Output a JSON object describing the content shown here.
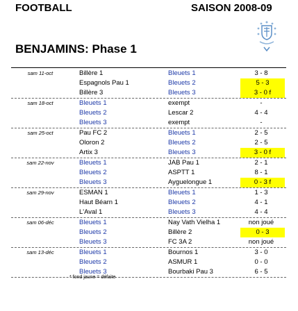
{
  "header": {
    "left_title": "FOOTBALL",
    "right_title": "SAISON 2008-09"
  },
  "subtitle": "BENJAMINS: Phase 1",
  "colors": {
    "blue_team": "#1e3aa8",
    "defeat_highlight": "#ffff00"
  },
  "groups": [
    {
      "date": "sam 11-oct",
      "rows": [
        {
          "home": "Billère 1",
          "home_blue": false,
          "away": "Bleuets 1",
          "away_blue": true,
          "score": "3 - 8",
          "highlight": false
        },
        {
          "home": "Espagnols Pau 1",
          "home_blue": false,
          "away": "Bleuets 2",
          "away_blue": true,
          "score": "5 - 3",
          "highlight": true
        },
        {
          "home": "Billère 3",
          "home_blue": false,
          "away": "Bleuets 3",
          "away_blue": true,
          "score": "3 - 0 f",
          "highlight": true
        }
      ]
    },
    {
      "date": "sam 18-oct",
      "rows": [
        {
          "home": "Bleuets 1",
          "home_blue": true,
          "away": "exempt",
          "away_blue": false,
          "score": "-",
          "highlight": false
        },
        {
          "home": "Bleuets 2",
          "home_blue": true,
          "away": "Lescar 2",
          "away_blue": false,
          "score": "4 - 4",
          "highlight": false
        },
        {
          "home": "Bleuets 3",
          "home_blue": true,
          "away": "exempt",
          "away_blue": false,
          "score": "-",
          "highlight": false
        }
      ]
    },
    {
      "date": "sam 25-oct",
      "rows": [
        {
          "home": "Pau FC 2",
          "home_blue": false,
          "away": "Bleuets 1",
          "away_blue": true,
          "score": "2 - 5",
          "highlight": false
        },
        {
          "home": "Oloron 2",
          "home_blue": false,
          "away": "Bleuets 2",
          "away_blue": true,
          "score": "2 - 5",
          "highlight": false
        },
        {
          "home": "Artix 3",
          "home_blue": false,
          "away": "Bleuets 3",
          "away_blue": true,
          "score": "3 - 0 f",
          "highlight": true
        }
      ]
    },
    {
      "date": "sam 22-nov",
      "rows": [
        {
          "home": "Bleuets 1",
          "home_blue": true,
          "away": "JAB Pau 1",
          "away_blue": false,
          "score": "2 - 1",
          "highlight": false
        },
        {
          "home": "Bleuets 2",
          "home_blue": true,
          "away": "ASPTT 1",
          "away_blue": false,
          "score": "8 - 1",
          "highlight": false
        },
        {
          "home": "Bleuets 3",
          "home_blue": true,
          "away": "Ayguelongue 1",
          "away_blue": false,
          "score": "0 - 3 f",
          "highlight": true
        }
      ]
    },
    {
      "date": "sam 29-nov",
      "rows": [
        {
          "home": "ESMAN 1",
          "home_blue": false,
          "away": "Bleuets 1",
          "away_blue": true,
          "score": "1 - 3",
          "highlight": false
        },
        {
          "home": "Haut Béarn 1",
          "home_blue": false,
          "away": "Bleuets 2",
          "away_blue": true,
          "score": "4 - 1",
          "highlight": false
        },
        {
          "home": "L'Aval 1",
          "home_blue": false,
          "away": "Bleuets 3",
          "away_blue": true,
          "score": "4 - 4",
          "highlight": false
        }
      ]
    },
    {
      "date": "sam 06-déc",
      "rows": [
        {
          "home": "Bleuets 1",
          "home_blue": true,
          "away": "Nay Vath Vielha 1",
          "away_blue": false,
          "score": "non joué",
          "highlight": false
        },
        {
          "home": "Bleuets 2",
          "home_blue": true,
          "away": "Billère 2",
          "away_blue": false,
          "score": "0 - 3",
          "highlight": true
        },
        {
          "home": "Bleuets 3",
          "home_blue": true,
          "away": "FC 3A 2",
          "away_blue": false,
          "score": "non joué",
          "highlight": false
        }
      ]
    },
    {
      "date": "sam 13-déc",
      "rows": [
        {
          "home": "Bleuets 1",
          "home_blue": true,
          "away": "Bournos 1",
          "away_blue": false,
          "score": "3 - 0",
          "highlight": false
        },
        {
          "home": "Bleuets 2",
          "home_blue": true,
          "away": "ASMUR 1",
          "away_blue": false,
          "score": "0 - 0",
          "highlight": false
        },
        {
          "home": "Bleuets 3",
          "home_blue": true,
          "away": "Bourbaki Pau 3",
          "away_blue": false,
          "score": "6 - 5",
          "highlight": false
        }
      ]
    }
  ],
  "footnote": "* fond jaune = défaite"
}
